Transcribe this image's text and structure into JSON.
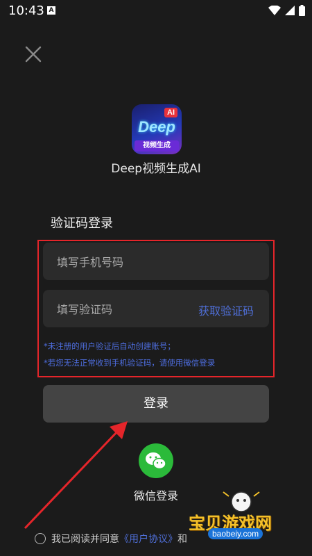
{
  "status_bar": {
    "time": "10:43",
    "notification_icon": "A"
  },
  "app": {
    "name": "Deep视频生成AI",
    "logo_ai": "AI",
    "logo_word": "Deep",
    "logo_band": "视频生成"
  },
  "login": {
    "section_title": "验证码登录",
    "phone_placeholder": "填写手机号码",
    "code_placeholder": "填写验证码",
    "get_code": "获取验证码",
    "notice_1": "*未注册的用户验证后自动创建账号；",
    "notice_2": "*若您无法正常收到手机验证码，请使用微信登录",
    "submit": "登录"
  },
  "wechat": {
    "label": "微信登录"
  },
  "agreement": {
    "prefix": "我已阅读并同意",
    "link": "《用户协议》",
    "suffix": "和"
  },
  "watermark": {
    "title": "宝贝游戏网",
    "url": "baobeiy.com"
  },
  "colors": {
    "background": "#1b1b1b",
    "accent_link": "#4f6fd8",
    "highlight_red": "#e5252a",
    "wechat_green": "#2bba3a"
  }
}
